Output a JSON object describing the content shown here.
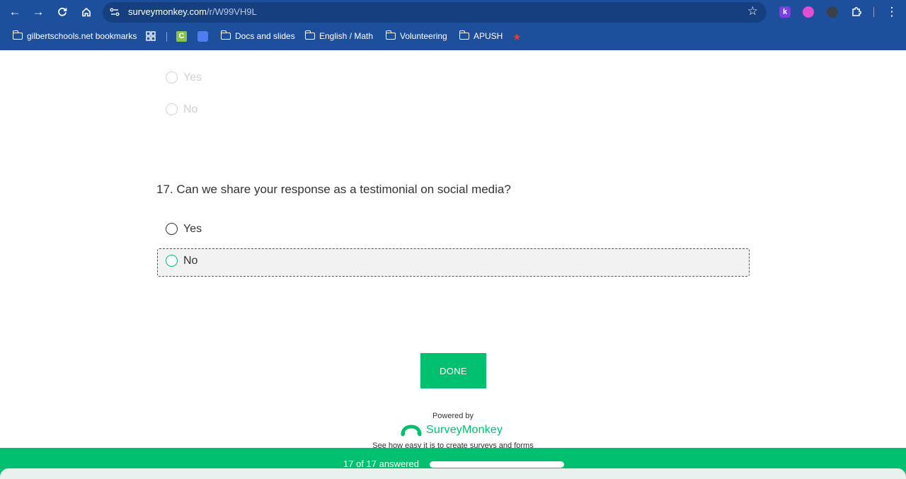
{
  "browser": {
    "url_host": "surveymonkey.com",
    "url_path": "/r/W99VH9L",
    "bookmarks": [
      {
        "label": "gilbertschools.net bookmarks",
        "icon": "folder-gear-icon"
      },
      {
        "label": "Docs and slides",
        "icon": "folder-icon"
      },
      {
        "label": "English / Math",
        "icon": "folder-icon"
      },
      {
        "label": "Volunteering",
        "icon": "folder-icon"
      },
      {
        "label": "APUSH",
        "icon": "folder-icon"
      }
    ]
  },
  "previous_question": {
    "options": [
      "Yes",
      "No"
    ]
  },
  "question17": {
    "text": "17. Can we share your response as a testimonial on social media?",
    "options": [
      "Yes",
      "No"
    ],
    "focused_option": "No"
  },
  "done_button": "DONE",
  "branding": {
    "powered_by": "Powered by",
    "name": "SurveyMonkey",
    "tagline": "See how easy it is to create surveys and forms"
  },
  "progress": {
    "label": "17 of 17 answered",
    "fraction": 1.0
  },
  "colors": {
    "brand_green": "#00bf6f",
    "chrome_blue": "#1e4f9c"
  }
}
